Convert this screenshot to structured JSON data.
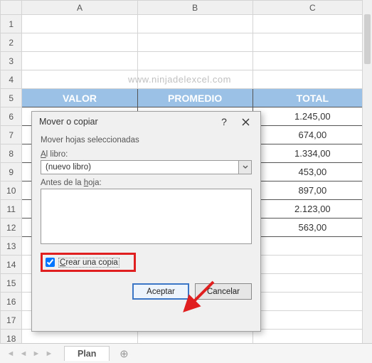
{
  "watermark": "www.ninjadelexcel.com",
  "columns": [
    "A",
    "B",
    "C"
  ],
  "row_numbers": [
    "1",
    "2",
    "3",
    "4",
    "5",
    "6",
    "7",
    "8",
    "9",
    "10",
    "11",
    "12",
    "13",
    "14",
    "15",
    "16",
    "17",
    "18"
  ],
  "table": {
    "headers": {
      "a": "VALOR",
      "b": "PROMEDIO",
      "c": "TOTAL"
    },
    "totals": [
      "1.245,00",
      "674,00",
      "1.334,00",
      "453,00",
      "897,00",
      "2.123,00",
      "563,00"
    ]
  },
  "dialog": {
    "title": "Mover o copiar",
    "help_symbol": "?",
    "subtitle": "Mover hojas seleccionadas",
    "book_label_pre": "A",
    "book_label_post": "l libro:",
    "book_value": "(nuevo libro)",
    "before_label_pre": "Antes de la ",
    "before_label_u": "h",
    "before_label_post": "oja:",
    "copy_label_pre": "C",
    "copy_label_post": "rear una copia",
    "ok": "Aceptar",
    "cancel": "Cancelar"
  },
  "tabs": {
    "active": "Plan",
    "nav": [
      "◄",
      "◄",
      "►",
      "►"
    ]
  }
}
